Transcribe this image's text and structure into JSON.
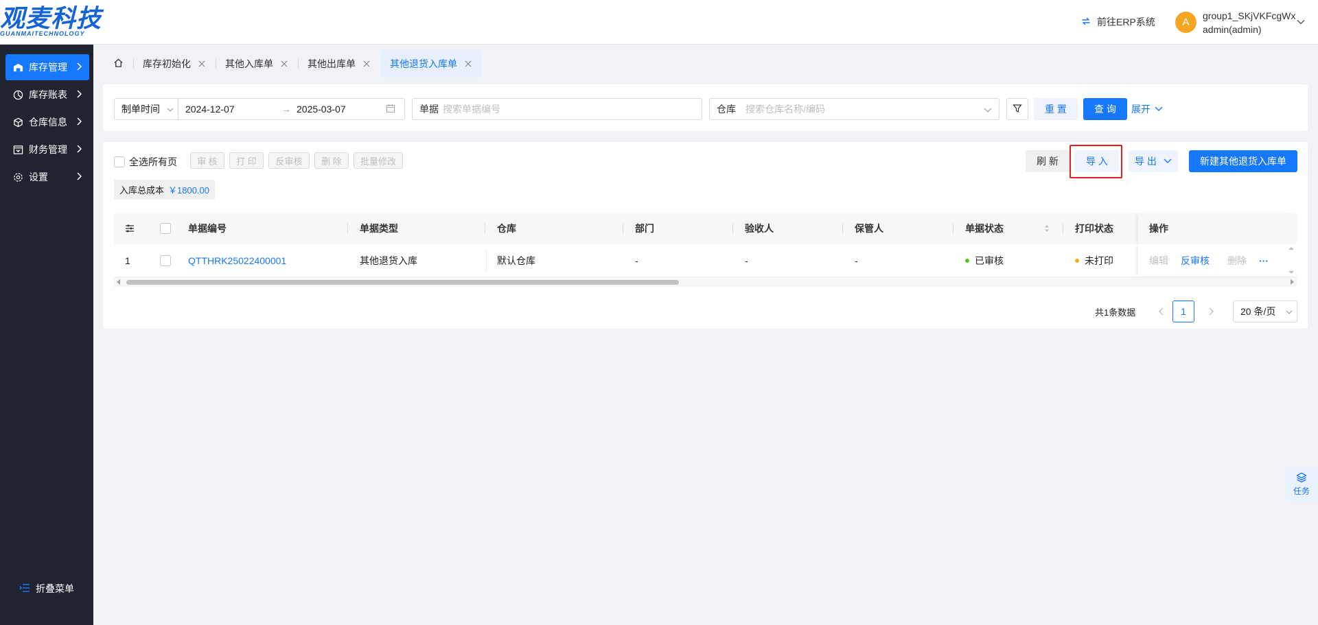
{
  "header": {
    "logo_cn": "观麦科技",
    "logo_en": "GUANMAITECHNOLOGY",
    "erp_link": "前往ERP系统",
    "avatar_letter": "A",
    "user_group": "group1_SKjVKFcgWx",
    "user_role": "admin(admin)"
  },
  "sidebar": {
    "items": [
      {
        "label": "库存管理",
        "icon": "warehouse-icon",
        "active": true
      },
      {
        "label": "库存账表",
        "icon": "pie-chart-icon"
      },
      {
        "label": "仓库信息",
        "icon": "cube-icon"
      },
      {
        "label": "财务管理",
        "icon": "finance-icon"
      },
      {
        "label": "设置",
        "icon": "gear-icon"
      }
    ],
    "collapse_label": "折叠菜单"
  },
  "tabs": [
    {
      "label": "库存初始化"
    },
    {
      "label": "其他入库单"
    },
    {
      "label": "其他出库单"
    },
    {
      "label": "其他退货入库单",
      "active": true
    }
  ],
  "filter": {
    "date_type": "制单时间",
    "start_date": "2024-12-07",
    "end_date": "2025-03-07",
    "doc_label": "单据",
    "doc_placeholder": "搜索单据编号",
    "warehouse_label": "仓库",
    "warehouse_placeholder": "搜索仓库名称/编码",
    "reset": "重 置",
    "query": "查 询",
    "expand": "展开"
  },
  "toolbar": {
    "select_all": "全选所有页",
    "approve": "审 核",
    "print": "打 印",
    "unapprove": "反审核",
    "delete": "删 除",
    "batch_edit": "批量修改",
    "refresh": "刷 新",
    "import": "导 入",
    "export": "导 出",
    "create": "新建其他退货入库单"
  },
  "summary": {
    "label": "入库总成本",
    "value": "￥1800.00"
  },
  "table": {
    "headers": {
      "code": "单据编号",
      "type": "单据类型",
      "warehouse": "仓库",
      "dept": "部门",
      "inspector": "验收人",
      "keeper": "保管人",
      "status": "单据状态",
      "print_status": "打印状态",
      "ops": "操作"
    },
    "rows": [
      {
        "index": "1",
        "code": "QTTHRK25022400001",
        "type": "其他退货入库",
        "warehouse": "默认仓库",
        "dept": "-",
        "inspector": "-",
        "keeper": "-",
        "status": "已审核",
        "status_color": "#52c41a",
        "print_status": "未打印",
        "print_color": "#faad14",
        "op_edit": "编辑",
        "op_unapprove": "反审核",
        "op_delete": "删除",
        "op_more": "···"
      }
    ]
  },
  "pagination": {
    "total": "共1条数据",
    "current": "1",
    "page_size": "20 条/页"
  },
  "float": {
    "task": "任务"
  }
}
